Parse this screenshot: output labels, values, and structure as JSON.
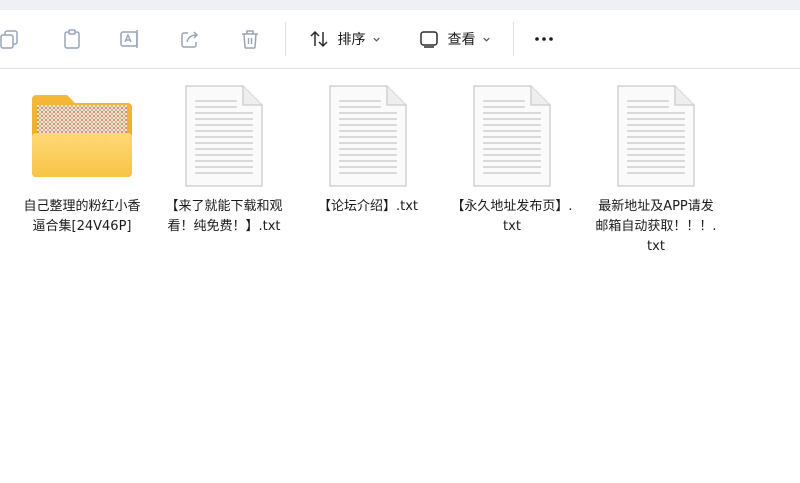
{
  "toolbar": {
    "sort_label": "排序",
    "view_label": "查看",
    "more_label": "···"
  },
  "files": [
    {
      "name": "自己整理的粉红小香逼合集[24V46P]",
      "type": "folder"
    },
    {
      "name": "【来了就能下载和观看！纯免费！】.txt",
      "type": "text"
    },
    {
      "name": "【论坛介绍】.txt",
      "type": "text"
    },
    {
      "name": "【永久地址发布页】.txt",
      "type": "text"
    },
    {
      "name": "最新地址及APP请发邮箱自动获取！！！.txt",
      "type": "text"
    }
  ]
}
